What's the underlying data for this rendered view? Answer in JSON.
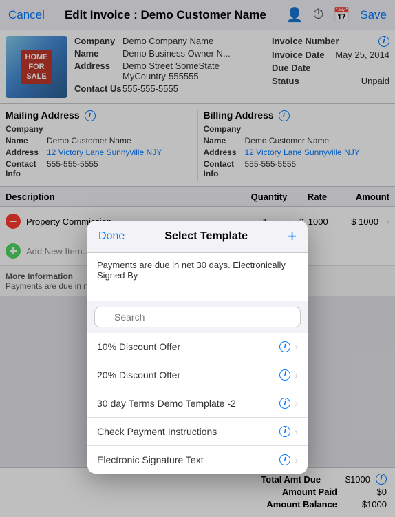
{
  "nav": {
    "cancel_label": "Cancel",
    "title": "Edit Invoice : Demo Customer Name",
    "save_label": "Save"
  },
  "company": {
    "name_label": "Company",
    "name_value": "Demo Company Name",
    "owner_label": "Name",
    "owner_value": "Demo Business Owner N...",
    "address_label": "Address",
    "address_value": "Demo Street SomeState MyCountry-555555",
    "contact_label": "Contact Us",
    "contact_value": "555-555-5555"
  },
  "invoice": {
    "number_label": "Invoice Number",
    "date_label": "Invoice Date",
    "date_value": "May 25, 2014",
    "due_label": "Due Date",
    "due_value": "",
    "status_label": "Status",
    "status_value": "Unpaid"
  },
  "mailing_address": {
    "title": "Mailing Address",
    "company_label": "Company",
    "company_value": "",
    "name_label": "Name",
    "name_value": "Demo Customer Name",
    "address_label": "Address",
    "address_value": "12 Victory Lane Sunnyville NJY",
    "contact_label": "Contact Info",
    "contact_value": "555-555-5555"
  },
  "billing_address": {
    "title": "Billing Address",
    "company_label": "Company",
    "company_value": "",
    "name_label": "Name",
    "name_value": "Demo Customer Name",
    "address_label": "Address",
    "address_value": "12 Victory Lane Sunnyville NJY",
    "contact_label": "Contact Info",
    "contact_value": "555-555-5555"
  },
  "table_headers": {
    "description": "Description",
    "quantity": "Quantity",
    "rate": "Rate",
    "amount": "Amount"
  },
  "line_items": [
    {
      "description": "Property Commission",
      "quantity": "1",
      "rate": "$ 1000",
      "amount": "$ 1000"
    }
  ],
  "add_item_label": "Add New Item...",
  "modal": {
    "done_label": "Done",
    "title": "Select Template",
    "add_label": "+",
    "notes": "Payments are due in net 30 days. Electronically Signed By -",
    "search_placeholder": "Search",
    "templates": [
      {
        "label": "10% Discount Offer"
      },
      {
        "label": "20% Discount Offer"
      },
      {
        "label": "30 day Terms Demo Template -2"
      },
      {
        "label": "Check Payment Instructions"
      },
      {
        "label": "Electronic Signature Text"
      }
    ]
  },
  "more_info": {
    "title": "More Information",
    "notes_preview": "Payments are due in net 30 days. ..."
  },
  "totals": {
    "total_amt_due_label": "Total Amt Due",
    "total_amt_due_value": "$1000",
    "amount_paid_label": "Amount Paid",
    "amount_paid_value": "$0",
    "amount_balance_label": "Amount Balance",
    "amount_balance_value": "$1000"
  }
}
